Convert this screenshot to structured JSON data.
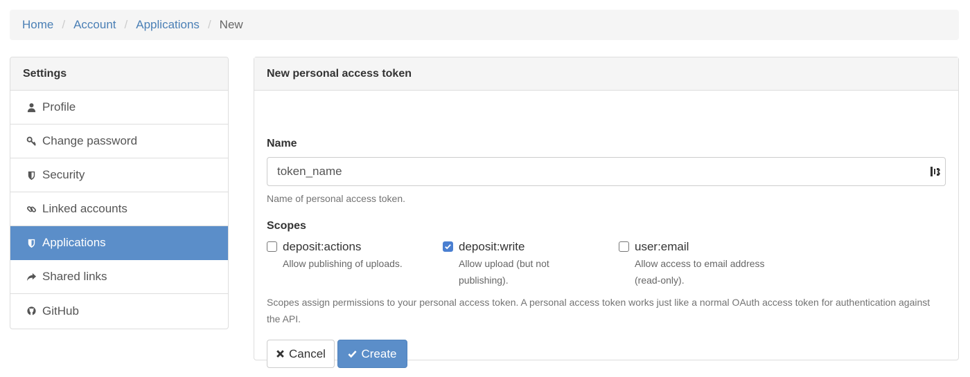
{
  "breadcrumb": {
    "items": [
      "Home",
      "Account",
      "Applications"
    ],
    "separator": "/",
    "active": "New"
  },
  "sidebar": {
    "heading": "Settings",
    "items": [
      {
        "label": "Profile",
        "icon": "user-icon",
        "active": false
      },
      {
        "label": "Change password",
        "icon": "key-icon",
        "active": false
      },
      {
        "label": "Security",
        "icon": "shield-icon",
        "active": false
      },
      {
        "label": "Linked accounts",
        "icon": "link-icon",
        "active": false
      },
      {
        "label": "Applications",
        "icon": "shield-icon",
        "active": true
      },
      {
        "label": "Shared links",
        "icon": "share-icon",
        "active": false
      },
      {
        "label": "GitHub",
        "icon": "github-icon",
        "active": false
      }
    ]
  },
  "form": {
    "heading": "New personal access token",
    "name_label": "Name",
    "name_value": "token_name",
    "name_help": "Name of personal access token.",
    "scopes_label": "Scopes",
    "scopes": [
      {
        "name": "deposit:actions",
        "desc": "Allow publishing of uploads.",
        "checked": false
      },
      {
        "name": "deposit:write",
        "desc": "Allow upload (but not publishing).",
        "checked": true
      },
      {
        "name": "user:email",
        "desc": "Allow access to email address (read-only).",
        "checked": false
      }
    ],
    "scopes_help": "Scopes assign permissions to your personal access token. A personal access token works just like a normal OAuth access token for authentication against the API.",
    "cancel_label": "Cancel",
    "create_label": "Create"
  },
  "colors": {
    "accent": "#5b8ec9",
    "link": "#4a7fb5",
    "checkbox_checked": "#4a7fd1"
  }
}
